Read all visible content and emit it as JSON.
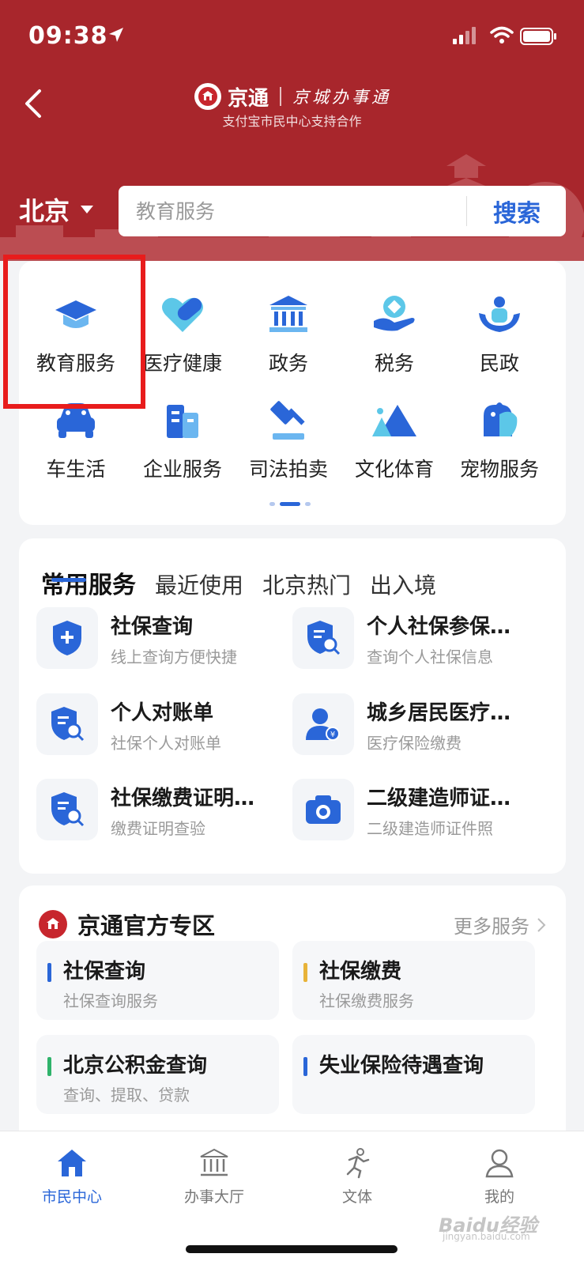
{
  "status_bar": {
    "time": "09:38"
  },
  "brand": {
    "name": "京通",
    "slogan": "京城办事通",
    "subtitle": "支付宝市民中心支持合作"
  },
  "city_selector": {
    "label": "北京"
  },
  "search": {
    "placeholder": "教育服务",
    "button_label": "搜索"
  },
  "categories": [
    {
      "label": "教育服务",
      "icon": "graduation-cap-icon"
    },
    {
      "label": "医疗健康",
      "icon": "heart-pill-icon"
    },
    {
      "label": "政务",
      "icon": "government-building-icon"
    },
    {
      "label": "税务",
      "icon": "tax-hand-icon"
    },
    {
      "label": "民政",
      "icon": "people-care-icon"
    },
    {
      "label": "车生活",
      "icon": "car-icon"
    },
    {
      "label": "企业服务",
      "icon": "office-building-icon"
    },
    {
      "label": "司法拍卖",
      "icon": "gavel-icon"
    },
    {
      "label": "文化体育",
      "icon": "mountain-culture-icon"
    },
    {
      "label": "宠物服务",
      "icon": "pet-icon"
    }
  ],
  "service_tabs": [
    "常用服务",
    "最近使用",
    "北京热门",
    "出入境"
  ],
  "services": [
    {
      "title": "社保查询",
      "desc": "线上查询方便快捷",
      "icon": "shield-plus-icon"
    },
    {
      "title": "个人社保参保…",
      "desc": "查询个人社保信息",
      "icon": "shield-search-icon"
    },
    {
      "title": "个人对账单",
      "desc": "社保个人对账单",
      "icon": "shield-search-icon"
    },
    {
      "title": "城乡居民医疗…",
      "desc": "医疗保险缴费",
      "icon": "person-yuan-icon"
    },
    {
      "title": "社保缴费证明…",
      "desc": "缴费证明查验",
      "icon": "shield-search-icon"
    },
    {
      "title": "二级建造师证…",
      "desc": "二级建造师证件照",
      "icon": "camera-icon"
    }
  ],
  "official_zone": {
    "title": "京通官方专区",
    "more_label": "更多服务",
    "items": [
      {
        "title": "社保查询",
        "desc": "社保查询服务",
        "accent": "#2a66d8"
      },
      {
        "title": "社保缴费",
        "desc": "社保缴费服务",
        "accent": "#e8b339"
      },
      {
        "title": "北京公积金查询",
        "desc": "查询、提取、贷款",
        "accent": "#2fb36b"
      },
      {
        "title": "失业保险待遇查询",
        "desc": "",
        "accent": "#2a66d8"
      }
    ]
  },
  "tab_bar": [
    {
      "label": "市民中心",
      "icon": "home-icon",
      "active": true
    },
    {
      "label": "办事大厅",
      "icon": "hall-icon",
      "active": false
    },
    {
      "label": "文体",
      "icon": "runner-icon",
      "active": false
    },
    {
      "label": "我的",
      "icon": "user-icon",
      "active": false
    }
  ],
  "watermark": {
    "text": "Baidu经验",
    "sub": "jingyan.baidu.com"
  },
  "colors": {
    "header_red": "#a8262c",
    "primary_blue": "#2a66d8",
    "highlight_red": "#e81c1c"
  }
}
